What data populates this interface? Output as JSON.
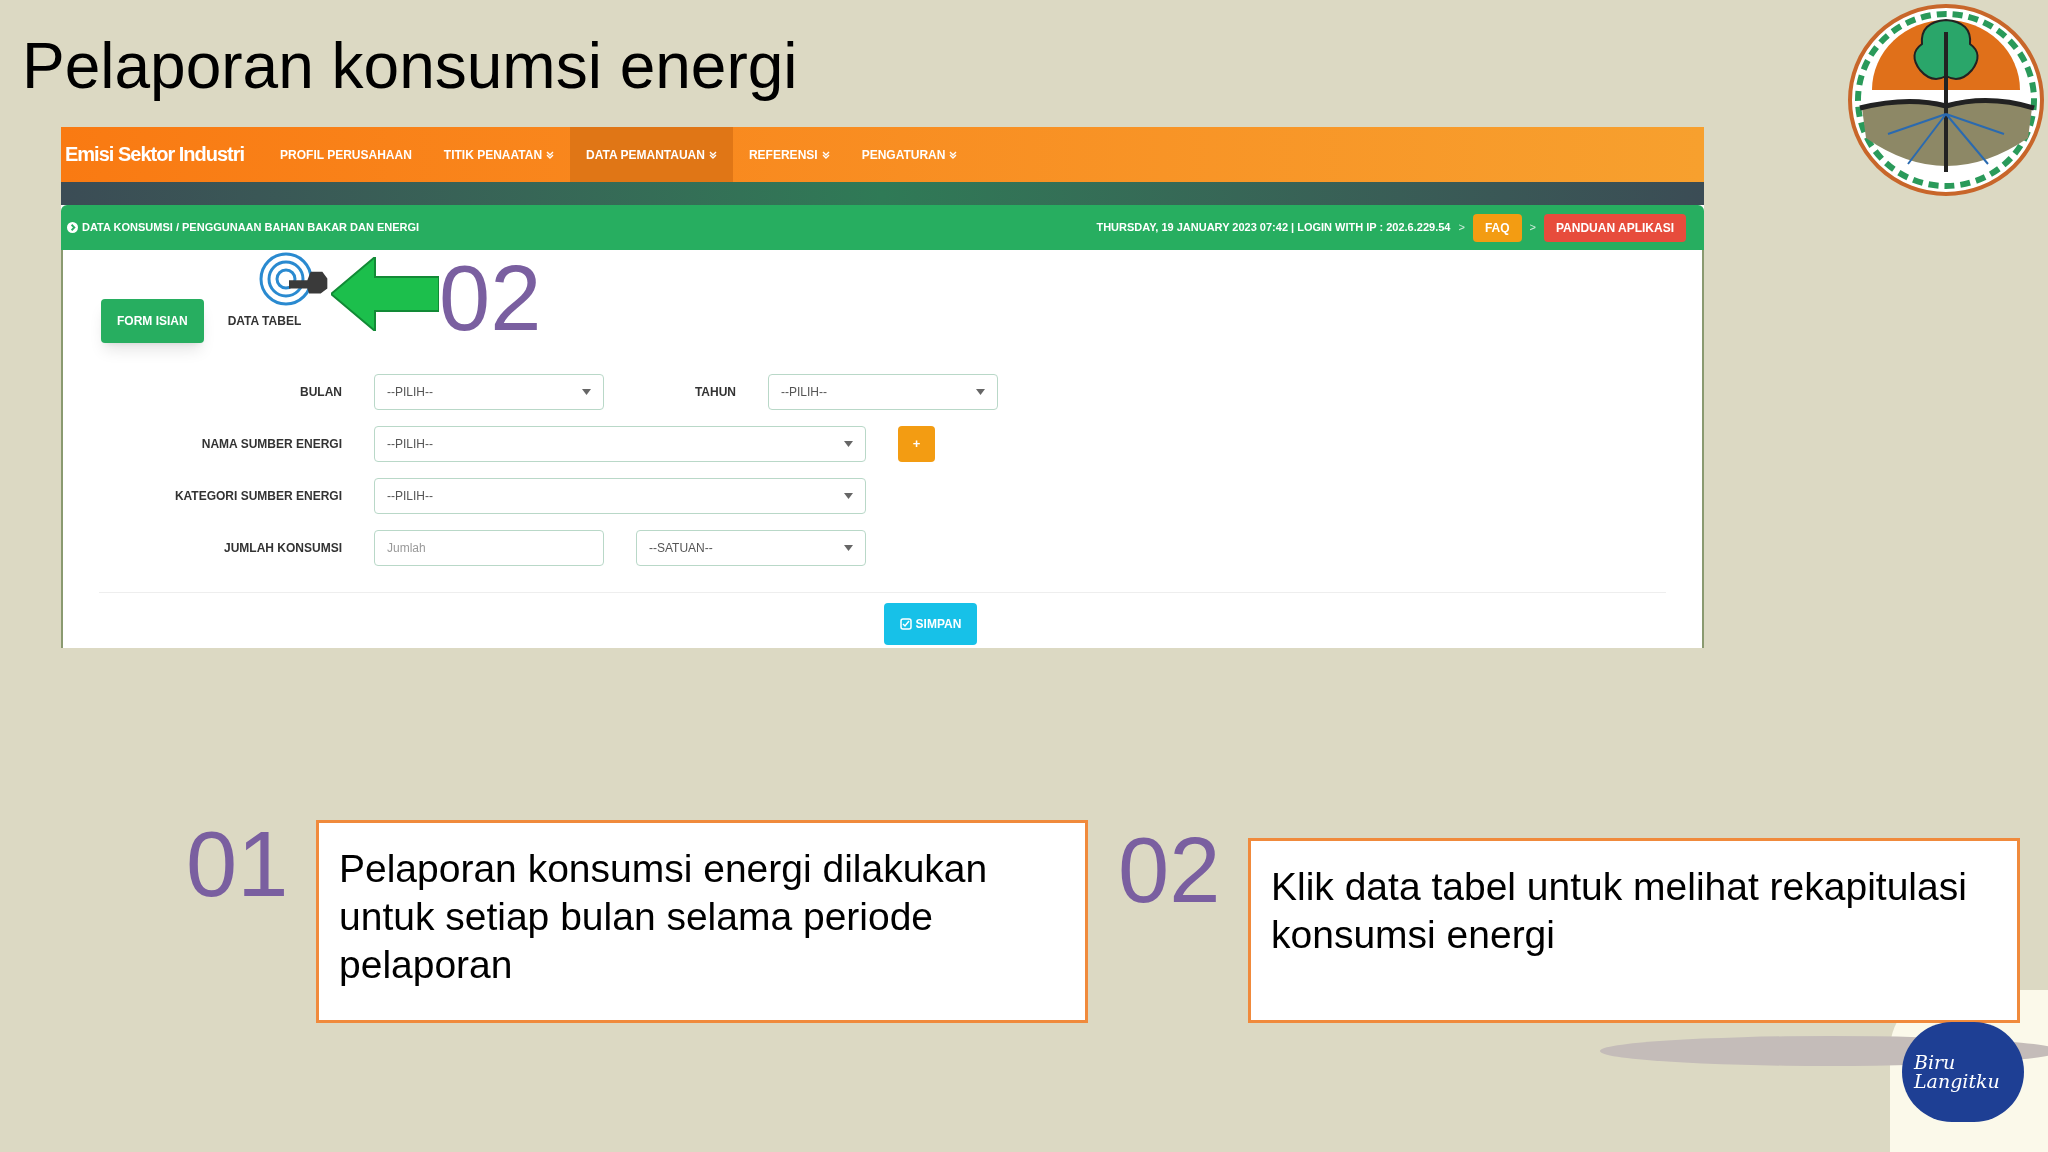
{
  "slide_title": "Pelaporan konsumsi energi",
  "app": {
    "brand": "Emisi Sektor Industri",
    "nav": [
      {
        "label": "PROFIL PERUSAHAAN",
        "selected": false,
        "dropdown": false
      },
      {
        "label": "TITIK PENAATAN",
        "selected": false,
        "dropdown": true
      },
      {
        "label": "DATA PEMANTAUAN",
        "selected": true,
        "dropdown": true
      },
      {
        "label": "REFERENSI",
        "selected": false,
        "dropdown": true
      },
      {
        "label": "PENGATURAN",
        "selected": false,
        "dropdown": true
      }
    ],
    "breadcrumb": "DATA KONSUMSI / PENGGUNAAN BAHAN BAKAR DAN ENERGI",
    "session_info": "THURSDAY, 19 JANUARY 2023 07:42 | LOGIN WITH IP : 202.6.229.54",
    "header_links": [
      {
        "separator": ">",
        "label": "FAQ",
        "kind": "faq"
      },
      {
        "separator": ">",
        "label": "PANDUAN APLIKASI",
        "kind": "guide"
      }
    ],
    "tabs": [
      {
        "label": "FORM ISIAN",
        "selected": true
      },
      {
        "label": "DATA TABEL",
        "selected": false
      }
    ],
    "callout_number": "02",
    "form": {
      "bulan": {
        "label": "BULAN",
        "value": "--PILIH--"
      },
      "tahun": {
        "label": "TAHUN",
        "value": "--PILIH--"
      },
      "nama_sumber": {
        "label": "NAMA SUMBER ENERGI",
        "value": "--PILIH--",
        "add_button": "+"
      },
      "kategori": {
        "label": "KATEGORI SUMBER ENERGI",
        "value": "--PILIH--"
      },
      "jumlah": {
        "label": "JUMLAH KONSUMSI",
        "placeholder": "Jumlah"
      },
      "satuan": {
        "value": "--SATUAN--"
      },
      "submit": "SIMPAN"
    }
  },
  "notes": [
    {
      "number": "01",
      "text": "Pelaporan konsumsi energi dilakukan untuk setiap bulan selama periode pelaporan"
    },
    {
      "number": "02",
      "text": "Klik data tabel untuk melihat rekapitulasi konsumsi energi"
    }
  ],
  "partner_logo": [
    "Biru",
    "Langitku"
  ]
}
